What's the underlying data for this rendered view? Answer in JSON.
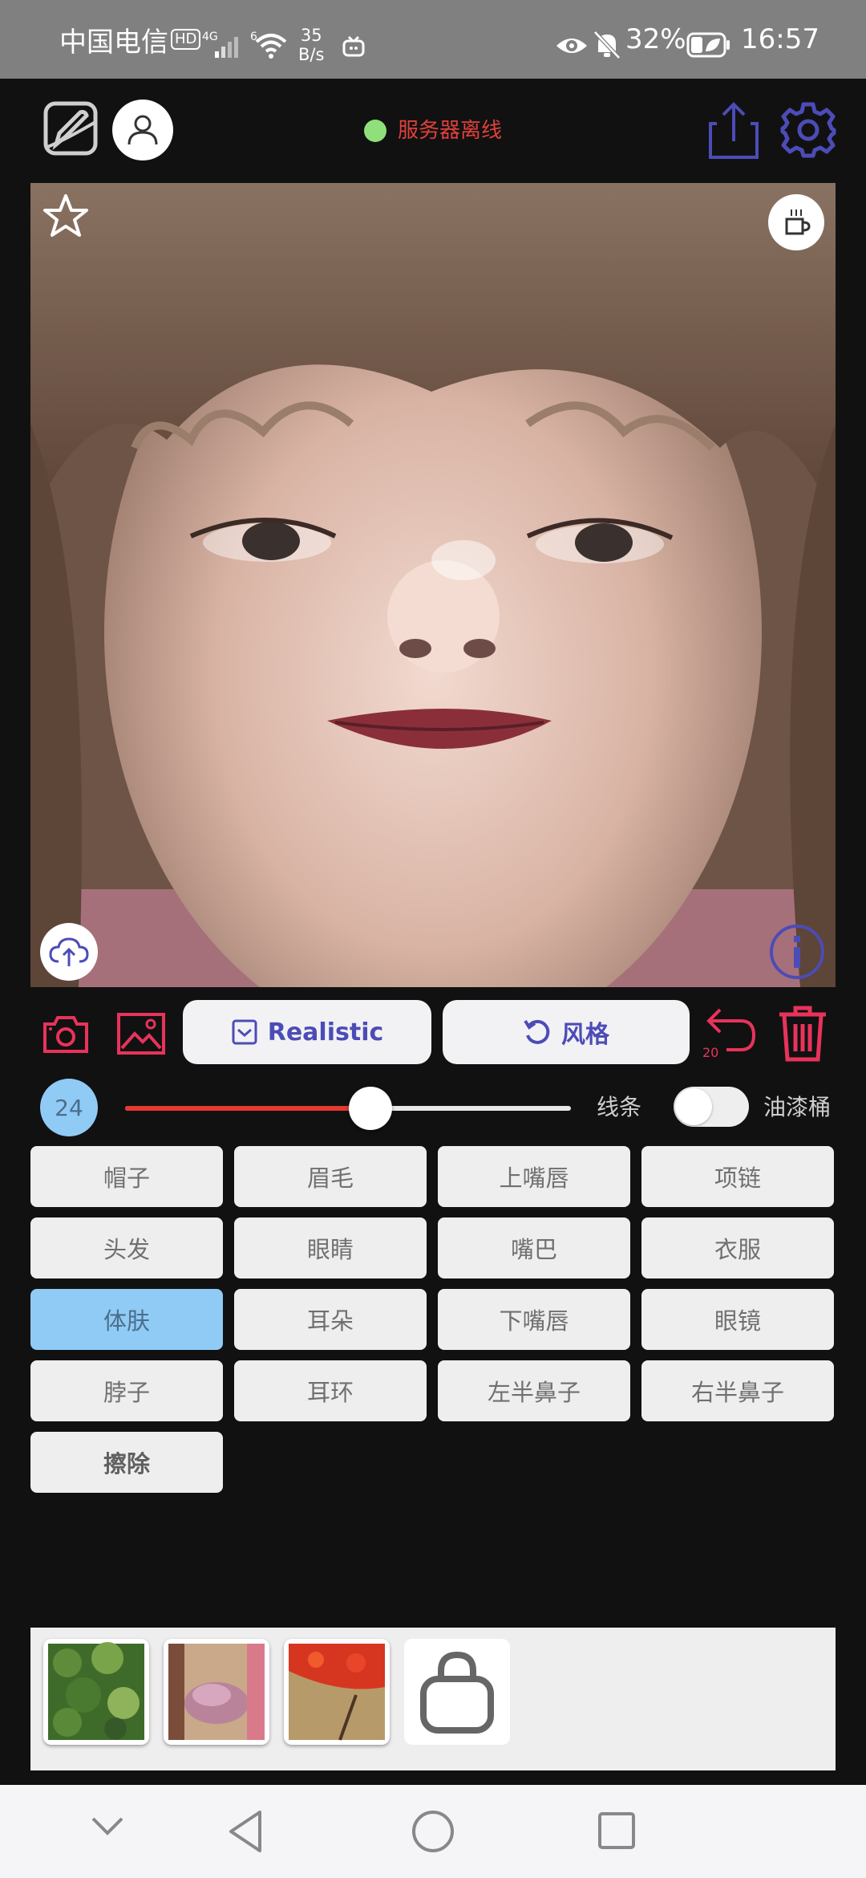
{
  "status_bar": {
    "carrier": "中国电信",
    "hd": "HD",
    "net1": "4G",
    "net2": "6",
    "speed_value": "35",
    "speed_unit": "B/s",
    "battery": "32%",
    "time": "16:57"
  },
  "header": {
    "server_status": "服务器离线",
    "status_dot_color": "#8fe07a",
    "status_text_color": "#e0403a"
  },
  "toolbar": {
    "realistic_label": "Realistic",
    "style_label": "风格",
    "undo_count": "20",
    "accent_color": "#e8335a"
  },
  "brush": {
    "size": "24",
    "slider_fraction": 0.55,
    "line_label": "线条",
    "bucket_label": "油漆桶",
    "bucket_enabled": false
  },
  "parts": [
    {
      "label": "帽子",
      "active": false
    },
    {
      "label": "眉毛",
      "active": false
    },
    {
      "label": "上嘴唇",
      "active": false
    },
    {
      "label": "项链",
      "active": false
    },
    {
      "label": "头发",
      "active": false
    },
    {
      "label": "眼睛",
      "active": false
    },
    {
      "label": "嘴巴",
      "active": false
    },
    {
      "label": "衣服",
      "active": false
    },
    {
      "label": "体肤",
      "active": true
    },
    {
      "label": "耳朵",
      "active": false
    },
    {
      "label": "下嘴唇",
      "active": false
    },
    {
      "label": "眼镜",
      "active": false
    },
    {
      "label": "脖子",
      "active": false
    },
    {
      "label": "耳环",
      "active": false
    },
    {
      "label": "左半鼻子",
      "active": false
    },
    {
      "label": "右半鼻子",
      "active": false
    },
    {
      "label": "擦除",
      "active": false
    }
  ],
  "styles_tray": {
    "items": [
      "green-foliage-texture",
      "pink-blossom-texture",
      "red-flower-texture",
      "lock-icon"
    ]
  }
}
